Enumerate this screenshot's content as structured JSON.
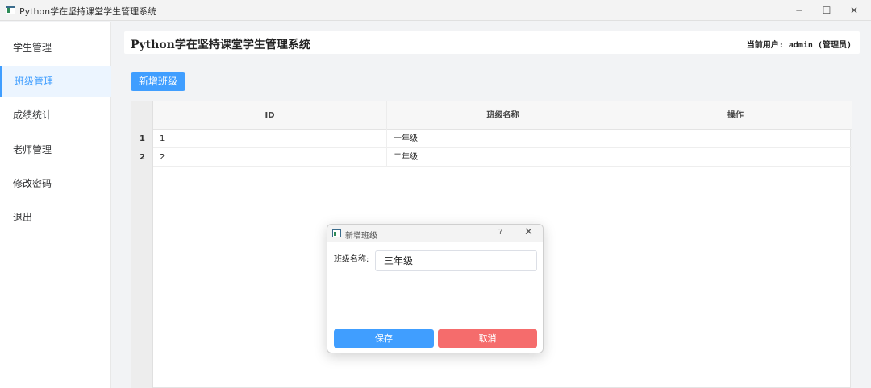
{
  "window": {
    "title": "Python学在坚持课堂学生管理系统",
    "minimize_glyph": "─",
    "maximize_glyph": "☐",
    "close_glyph": "✕"
  },
  "sidebar": {
    "items": [
      {
        "label": "学生管理",
        "active": false
      },
      {
        "label": "班级管理",
        "active": true
      },
      {
        "label": "成绩统计",
        "active": false
      },
      {
        "label": "老师管理",
        "active": false
      },
      {
        "label": "修改密码",
        "active": false
      },
      {
        "label": "退出",
        "active": false
      }
    ]
  },
  "header": {
    "title": "Python学在坚持课堂学生管理系统",
    "user_info": "当前用户: admin (管理员)"
  },
  "toolbar": {
    "add_label": "新增班级"
  },
  "table": {
    "columns": [
      "ID",
      "班级名称",
      "操作"
    ],
    "rows": [
      {
        "num": "1",
        "id": "1",
        "name": "一年级",
        "action": ""
      },
      {
        "num": "2",
        "id": "2",
        "name": "二年级",
        "action": ""
      }
    ]
  },
  "dialog": {
    "title": "新增班级",
    "help_glyph": "?",
    "close_glyph": "✕",
    "field_label": "班级名称:",
    "field_value": "三年级",
    "save_label": "保存",
    "cancel_label": "取消"
  },
  "colors": {
    "primary": "#409eff",
    "danger": "#f56c6c",
    "active_bg": "#ecf5ff"
  }
}
